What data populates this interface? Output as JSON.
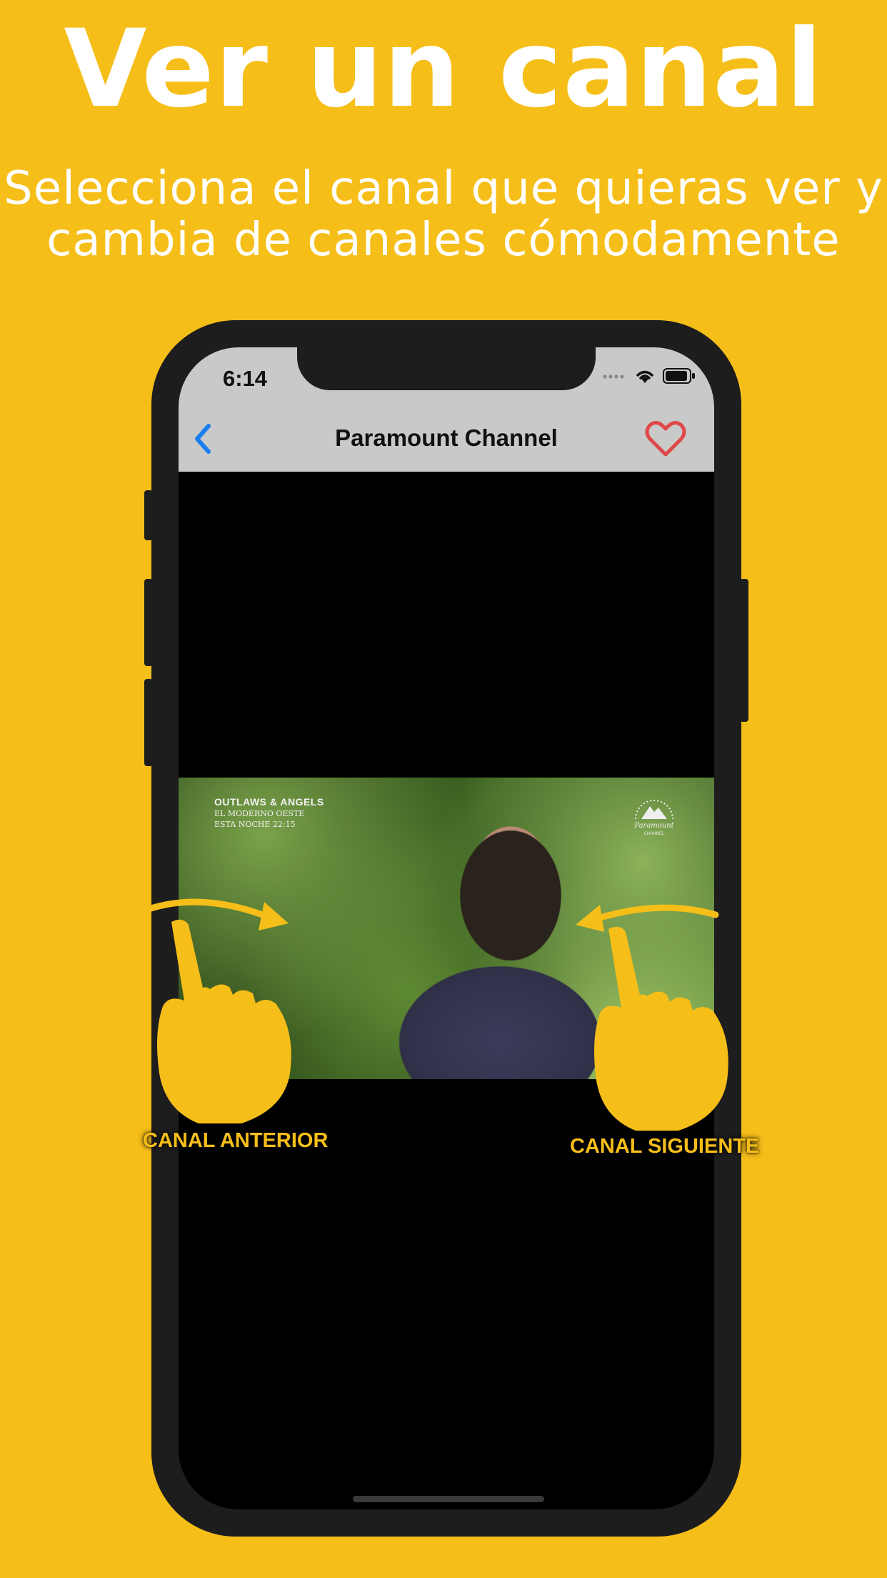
{
  "headline": "Ver un canal",
  "subheadline": [
    "Selecciona el canal que quieras ver y",
    "cambia de canales cómodamente"
  ],
  "phone": {
    "status_bar": {
      "time": "6:14",
      "icons": [
        "signal-icon",
        "wifi-icon",
        "battery-icon"
      ]
    },
    "nav": {
      "title": "Paramount Channel",
      "back_icon": "chevron-left-icon",
      "favorite_icon": "heart-icon"
    },
    "video": {
      "overlay_title": "OUTLAWS & ANGELS",
      "overlay_line2": "EL MODERNO OESTE",
      "overlay_line3": "ESTA NOCHE 22:15",
      "logo_text": "Paramount",
      "logo_sub": "CHANNEL"
    }
  },
  "gestures": {
    "left_caption": "CANAL ANTERIOR",
    "right_caption": "CANAL SIGUIENTE"
  },
  "colors": {
    "background": "#F6BE19",
    "accent_blue": "#1a7ef0",
    "heart_red": "#e04848",
    "gesture_yellow": "#F6BE19"
  }
}
